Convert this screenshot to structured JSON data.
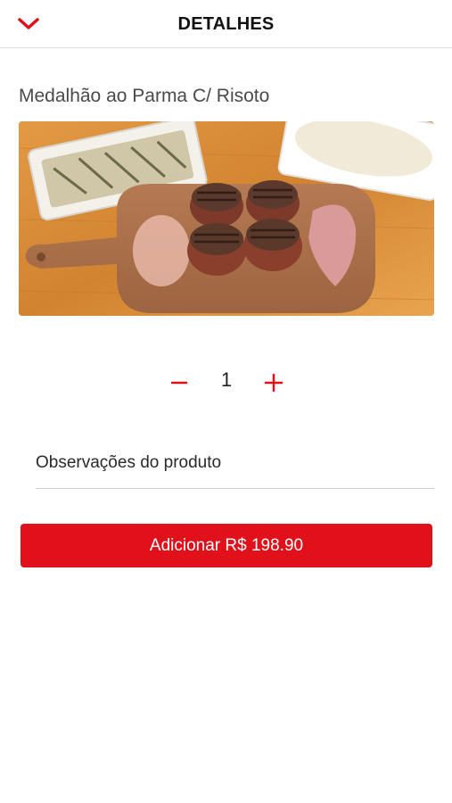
{
  "header": {
    "title": "DETALHES",
    "back_icon": "chevron-down-icon"
  },
  "product": {
    "name": "Medalhão ao Parma C/ Risoto",
    "image_icon": "product-photo"
  },
  "quantity": {
    "value": "1",
    "minus_icon": "minus-icon",
    "plus_icon": "plus-icon"
  },
  "notes": {
    "placeholder": "Observações do produto",
    "value": ""
  },
  "add_button": {
    "label": "Adicionar R$ 198.90"
  },
  "colors": {
    "accent": "#e0111b",
    "text": "#4a4a4a"
  }
}
